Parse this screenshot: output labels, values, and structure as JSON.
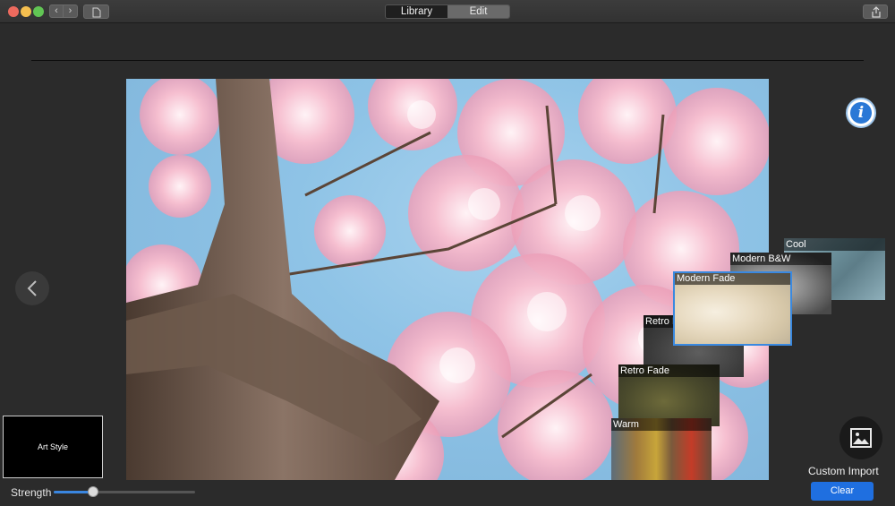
{
  "titlebar": {
    "nav_back_glyph": "‹",
    "nav_forward_glyph": "›",
    "tabs": [
      {
        "label": "Library",
        "active": true
      },
      {
        "label": "Edit",
        "active": false
      }
    ]
  },
  "filters": {
    "cool": "Cool",
    "modern_bw": "Modern B&W",
    "modern_fade": "Modern Fade",
    "retro_b": "Retro B",
    "retro_fade": "Retro Fade",
    "warm": "Warm"
  },
  "art_style": {
    "label": "Art Style"
  },
  "strength": {
    "label": "Strength",
    "value_fraction": 0.28
  },
  "custom_import": {
    "label": "Custom Import"
  },
  "clear": {
    "label": "Clear"
  },
  "colors": {
    "accent": "#1f6fe0",
    "selection": "#3a89e0",
    "background": "#2b2b2b"
  }
}
